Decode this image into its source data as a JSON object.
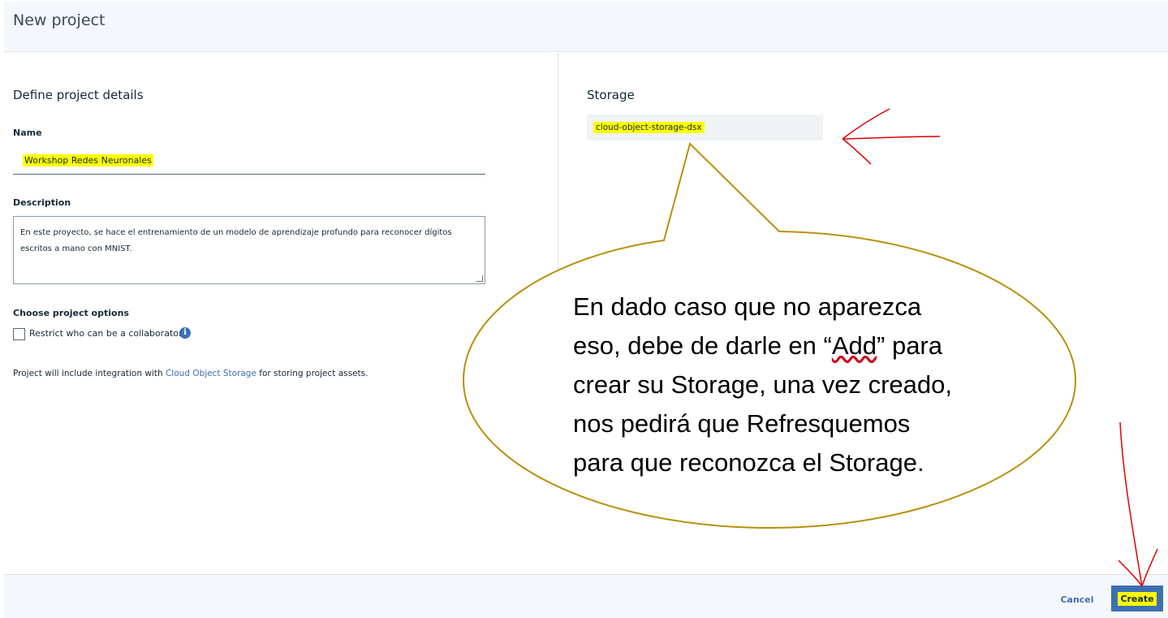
{
  "header": {
    "title": "New project"
  },
  "details": {
    "section_title": "Define project details",
    "name_label": "Name",
    "name_value": "Workshop Redes Neuronales",
    "description_label": "Description",
    "description_value": "En este proyecto, se hace el entrenamiento de un modelo de aprendizaje profundo para reconocer dígitos escritos a mano con MNIST.",
    "options_label": "Choose project options",
    "restrict_label": "Restrict who can be a collaborator",
    "integration_prefix": "Project will include integration with ",
    "integration_link": "Cloud Object Storage",
    "integration_suffix": " for storing project assets."
  },
  "storage": {
    "section_title": "Storage",
    "value": "cloud-object-storage-dsx"
  },
  "annotation": {
    "line1": "En dado caso que no aparezca",
    "line2_a": "eso, debe de darle en “",
    "line2_word": "Add",
    "line2_b": "” para",
    "line3": "crear su Storage, una vez creado,",
    "line4": "nos pedirá que Refresquemos",
    "line5": "para que reconozca el Storage.",
    "bubble_color": "#b8900a",
    "arrow_color": "#e00000"
  },
  "footer": {
    "cancel_label": "Cancel",
    "create_label": "Create"
  },
  "colors": {
    "accent": "#3d70b2",
    "highlight": "#ffff00"
  }
}
